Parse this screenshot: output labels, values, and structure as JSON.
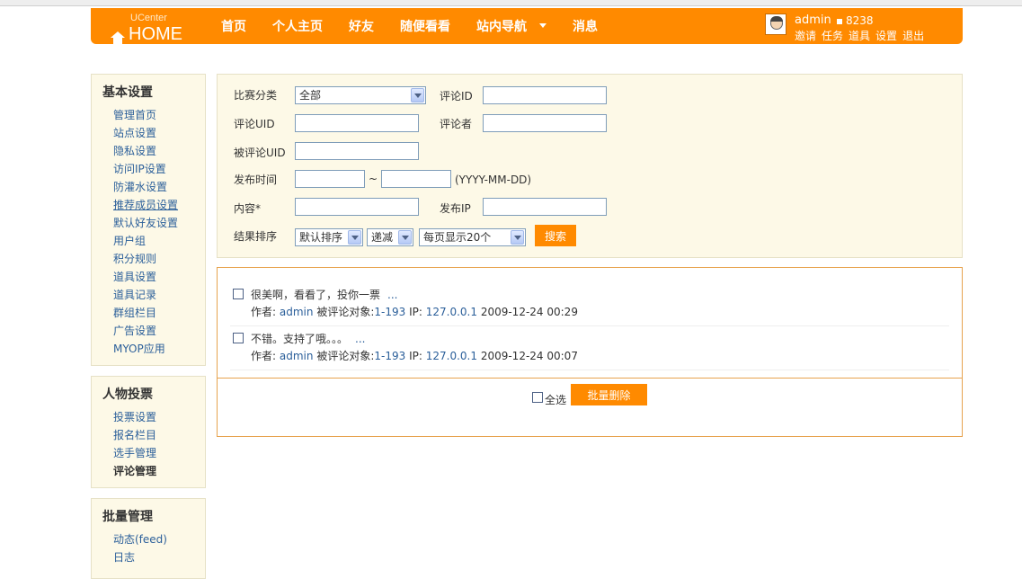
{
  "header": {
    "logo_small": "UCenter",
    "logo_big": "HOME",
    "nav": [
      "首页",
      "个人主页",
      "好友",
      "随便看看",
      "站内导航",
      "消息"
    ],
    "user": {
      "name": "admin",
      "credit": "8238",
      "links": [
        "邀请",
        "任务",
        "道具",
        "设置",
        "退出"
      ]
    }
  },
  "sidebar": {
    "basic": {
      "title": "基本设置",
      "items": [
        "管理首页",
        "站点设置",
        "隐私设置",
        "访问IP设置",
        "防灌水设置",
        "推荐成员设置",
        "默认好友设置",
        "用户组",
        "积分规则",
        "道具设置",
        "道具记录",
        "群组栏目",
        "广告设置",
        "MYOP应用"
      ]
    },
    "vote": {
      "title": "人物投票",
      "items": [
        "投票设置",
        "报名栏目",
        "选手管理",
        "评论管理"
      ]
    },
    "batch": {
      "title": "批量管理",
      "items": [
        "动态(feed)",
        "日志"
      ]
    }
  },
  "search": {
    "category_label": "比赛分类",
    "category_value": "全部",
    "comment_id_label": "评论ID",
    "comment_id_value": "",
    "comment_uid_label": "评论UID",
    "comment_uid_value": "",
    "commenter_label": "评论者",
    "commenter_value": "",
    "target_uid_label": "被评论UID",
    "target_uid_value": "",
    "time_label": "发布时间",
    "time_from": "",
    "time_to": "",
    "time_sep": "~",
    "time_hint": "(YYYY-MM-DD)",
    "content_label": "内容*",
    "content_value": "",
    "ip_label": "发布IP",
    "ip_value": "",
    "sort_label": "结果排序",
    "sort_value": "默认排序",
    "order_value": "递减",
    "perpage_value": "每页显示20个",
    "search_button": "搜索"
  },
  "results": {
    "items": [
      {
        "message": "很美啊，看看了，投你一票",
        "more": "...",
        "author_label": "作者:",
        "author": "admin",
        "target_label": "被评论对象:",
        "target": "1-193",
        "ip_label": "IP:",
        "ip": "127.0.0.1",
        "time": "2009-12-24 00:29"
      },
      {
        "message": "不错。支持了哦。。。",
        "more": "...",
        "author_label": "作者:",
        "author": "admin",
        "target_label": "被评论对象:",
        "target": "1-193",
        "ip_label": "IP:",
        "ip": "127.0.0.1",
        "time": "2009-12-24 00:07"
      }
    ],
    "select_all_label": "全选",
    "batch_delete_button": "批量删除"
  }
}
